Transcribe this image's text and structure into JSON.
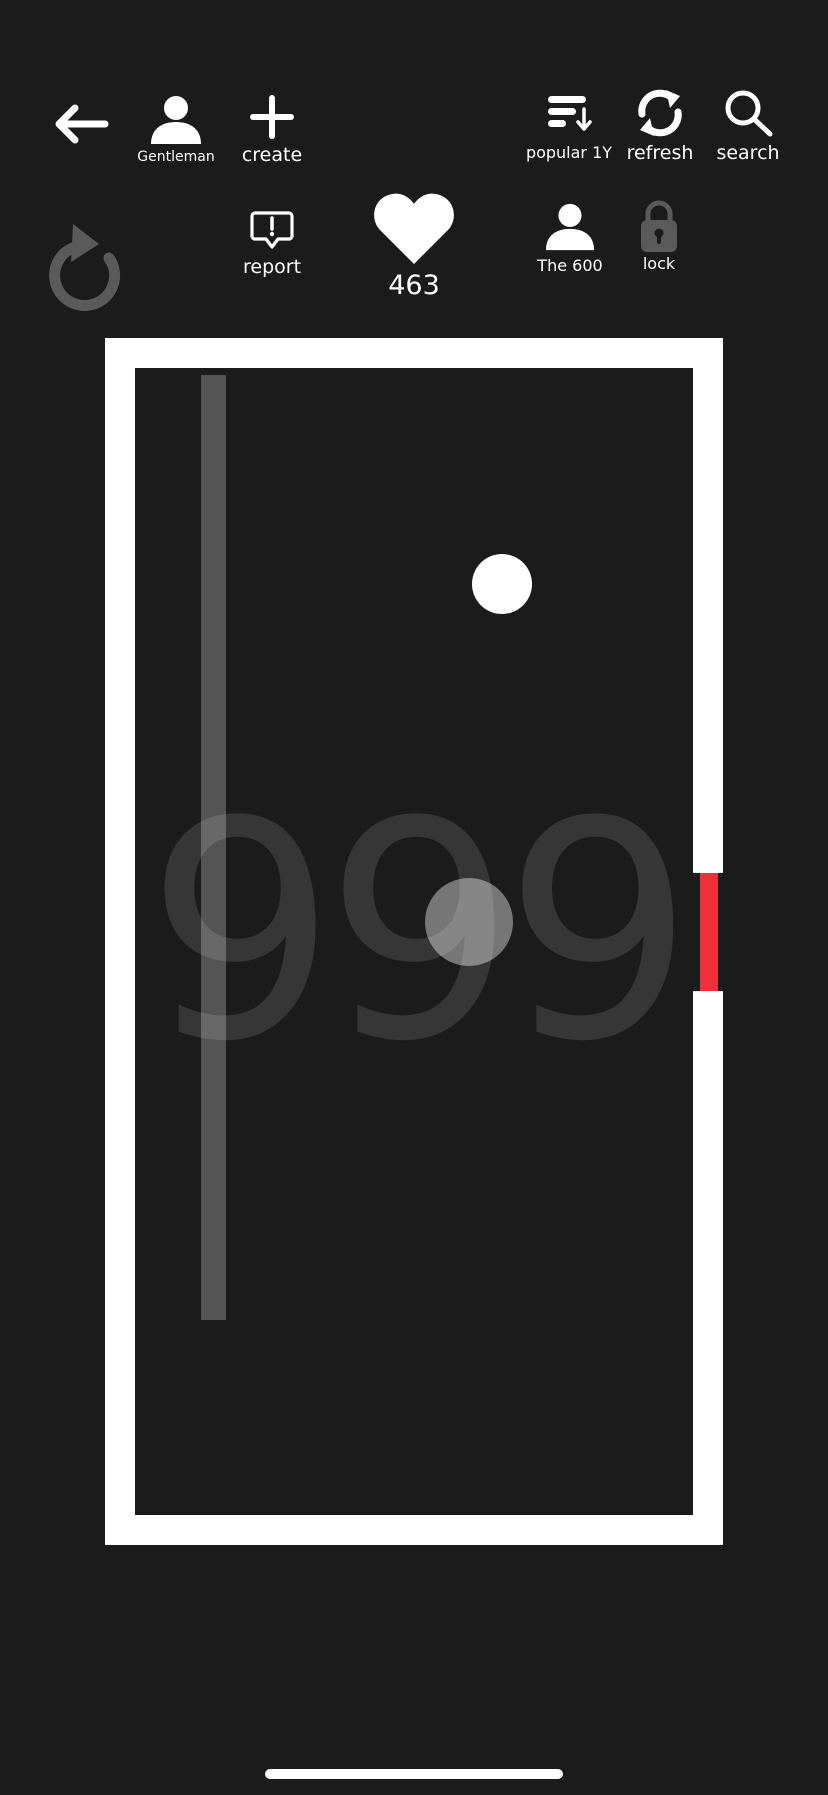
{
  "toolbar": {
    "back_icon": "back-arrow-icon",
    "profile": {
      "label": "Gentleman",
      "icon": "person-icon"
    },
    "create": {
      "label": "create",
      "icon": "plus-icon"
    },
    "sort": {
      "label": "popular 1Y",
      "icon": "sort-icon"
    },
    "refresh": {
      "label": "refresh",
      "icon": "refresh-icon"
    },
    "search": {
      "label": "search",
      "icon": "search-icon"
    }
  },
  "actions": {
    "restart_icon": "restart-icon",
    "report": {
      "label": "report",
      "icon": "report-icon"
    },
    "like": {
      "count": "463",
      "icon": "heart-icon"
    },
    "author": {
      "label": "The 600",
      "icon": "person-icon"
    },
    "lock": {
      "label": "lock",
      "icon": "lock-icon"
    }
  },
  "game": {
    "score": "999",
    "colors": {
      "background": "#1b1b1b",
      "wall": "#ffffff",
      "goal": "#f0303a",
      "ball": "#ffffff"
    }
  }
}
